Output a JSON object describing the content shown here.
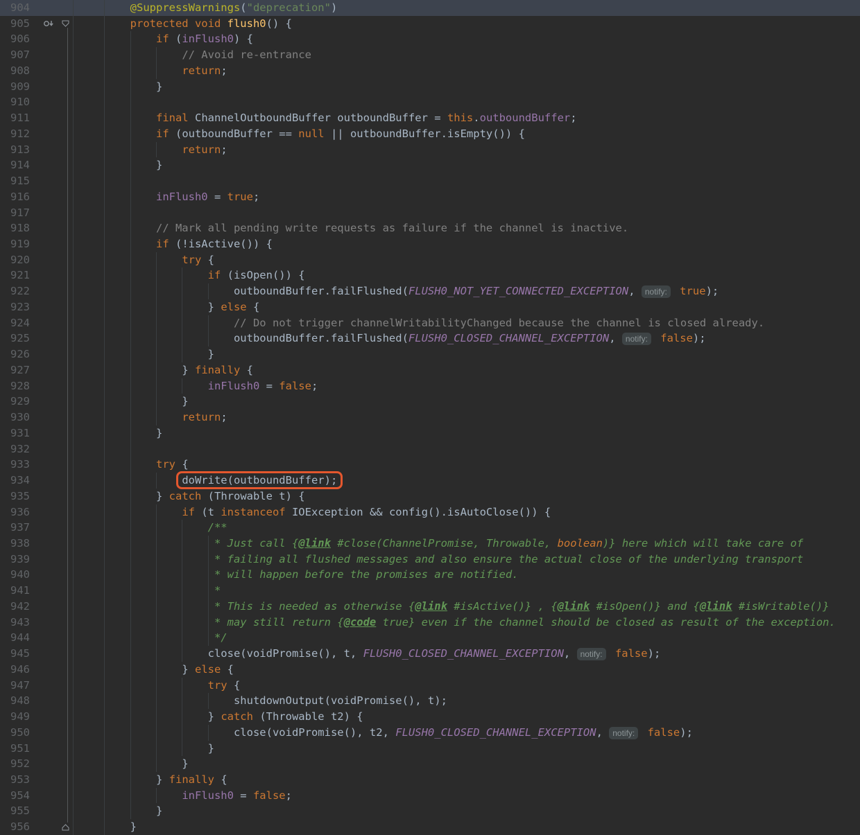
{
  "editor": {
    "palette": {
      "background": "#2b2b2b",
      "caretLine": "#3d434e",
      "lineNumber": "#606366",
      "gutterLine": "#3a3d3f",
      "guide": "#3a3e41",
      "foldLine": "#55585a",
      "d": "#a9b7c6",
      "kw": "#cc7832",
      "ann": "#bbb529",
      "str": "#6a8759",
      "cmt": "#808080",
      "doc": "#629755",
      "fld": "#9876aa",
      "cst": "#9876aa",
      "mth": "#ffc66d",
      "hintBg": "#3e4446",
      "hintText": "#8c9496",
      "box": "#e4572e",
      "icon": "#8f959b"
    },
    "inlay_hint_label": "notify:",
    "highlight_box": {
      "line": 934,
      "text": "doWrite(outboundBuffer);",
      "color": "#e4572e"
    },
    "lines": [
      {
        "n": 904,
        "caret": true,
        "seg": [
          [
            "d",
            "        "
          ],
          [
            "ann",
            "@SuppressWarnings"
          ],
          [
            "d",
            "("
          ],
          [
            "str",
            "\"deprecation\""
          ],
          [
            "d",
            ")"
          ]
        ]
      },
      {
        "n": 905,
        "icons": [
          "overridden-method-icon",
          "fold-start-icon"
        ],
        "seg": [
          [
            "d",
            "        "
          ],
          [
            "kw",
            "protected void "
          ],
          [
            "mth",
            "flush0"
          ],
          [
            "d",
            "() {"
          ]
        ]
      },
      {
        "n": 906,
        "seg": [
          [
            "d",
            "            "
          ],
          [
            "kw",
            "if "
          ],
          [
            "d",
            "("
          ],
          [
            "fld",
            "inFlush0"
          ],
          [
            "d",
            ") {"
          ]
        ]
      },
      {
        "n": 907,
        "seg": [
          [
            "d",
            "                "
          ],
          [
            "cmt",
            "// Avoid re-entrance"
          ]
        ]
      },
      {
        "n": 908,
        "seg": [
          [
            "d",
            "                "
          ],
          [
            "kw",
            "return"
          ],
          [
            "d",
            ";"
          ]
        ]
      },
      {
        "n": 909,
        "seg": [
          [
            "d",
            "            }"
          ]
        ]
      },
      {
        "n": 910,
        "seg": []
      },
      {
        "n": 911,
        "seg": [
          [
            "d",
            "            "
          ],
          [
            "kw",
            "final "
          ],
          [
            "d",
            "ChannelOutboundBuffer outboundBuffer = "
          ],
          [
            "kw",
            "this"
          ],
          [
            "d",
            "."
          ],
          [
            "fld",
            "outboundBuffer"
          ],
          [
            "d",
            ";"
          ]
        ]
      },
      {
        "n": 912,
        "seg": [
          [
            "d",
            "            "
          ],
          [
            "kw",
            "if "
          ],
          [
            "d",
            "(outboundBuffer == "
          ],
          [
            "kw",
            "null"
          ],
          [
            "d",
            " || outboundBuffer.isEmpty()) {"
          ]
        ]
      },
      {
        "n": 913,
        "seg": [
          [
            "d",
            "                "
          ],
          [
            "kw",
            "return"
          ],
          [
            "d",
            ";"
          ]
        ]
      },
      {
        "n": 914,
        "seg": [
          [
            "d",
            "            }"
          ]
        ]
      },
      {
        "n": 915,
        "seg": []
      },
      {
        "n": 916,
        "seg": [
          [
            "d",
            "            "
          ],
          [
            "fld",
            "inFlush0"
          ],
          [
            "d",
            " = "
          ],
          [
            "kw",
            "true"
          ],
          [
            "d",
            ";"
          ]
        ]
      },
      {
        "n": 917,
        "seg": []
      },
      {
        "n": 918,
        "seg": [
          [
            "d",
            "            "
          ],
          [
            "cmt",
            "// Mark all pending write requests as failure if the channel is inactive."
          ]
        ]
      },
      {
        "n": 919,
        "seg": [
          [
            "d",
            "            "
          ],
          [
            "kw",
            "if "
          ],
          [
            "d",
            "(!isActive()) {"
          ]
        ]
      },
      {
        "n": 920,
        "seg": [
          [
            "d",
            "                "
          ],
          [
            "kw",
            "try "
          ],
          [
            "d",
            "{"
          ]
        ]
      },
      {
        "n": 921,
        "seg": [
          [
            "d",
            "                    "
          ],
          [
            "kw",
            "if "
          ],
          [
            "d",
            "(isOpen()) {"
          ]
        ]
      },
      {
        "n": 922,
        "seg": [
          [
            "d",
            "                        outboundBuffer.failFlushed("
          ],
          [
            "cst",
            "FLUSH0_NOT_YET_CONNECTED_EXCEPTION"
          ],
          [
            "d",
            ", "
          ],
          [
            "hint",
            "notify:"
          ],
          [
            "d",
            " "
          ],
          [
            "kw",
            "true"
          ],
          [
            "d",
            ");"
          ]
        ]
      },
      {
        "n": 923,
        "seg": [
          [
            "d",
            "                    } "
          ],
          [
            "kw",
            "else "
          ],
          [
            "d",
            "{"
          ]
        ]
      },
      {
        "n": 924,
        "seg": [
          [
            "d",
            "                        "
          ],
          [
            "cmt",
            "// Do not trigger channelWritabilityChanged because the channel is closed already."
          ]
        ]
      },
      {
        "n": 925,
        "seg": [
          [
            "d",
            "                        outboundBuffer.failFlushed("
          ],
          [
            "cst",
            "FLUSH0_CLOSED_CHANNEL_EXCEPTION"
          ],
          [
            "d",
            ", "
          ],
          [
            "hint",
            "notify:"
          ],
          [
            "d",
            " "
          ],
          [
            "kw",
            "false"
          ],
          [
            "d",
            ");"
          ]
        ]
      },
      {
        "n": 926,
        "seg": [
          [
            "d",
            "                    }"
          ]
        ]
      },
      {
        "n": 927,
        "seg": [
          [
            "d",
            "                } "
          ],
          [
            "kw",
            "finally "
          ],
          [
            "d",
            "{"
          ]
        ]
      },
      {
        "n": 928,
        "seg": [
          [
            "d",
            "                    "
          ],
          [
            "fld",
            "inFlush0"
          ],
          [
            "d",
            " = "
          ],
          [
            "kw",
            "false"
          ],
          [
            "d",
            ";"
          ]
        ]
      },
      {
        "n": 929,
        "seg": [
          [
            "d",
            "                }"
          ]
        ]
      },
      {
        "n": 930,
        "seg": [
          [
            "d",
            "                "
          ],
          [
            "kw",
            "return"
          ],
          [
            "d",
            ";"
          ]
        ]
      },
      {
        "n": 931,
        "seg": [
          [
            "d",
            "            }"
          ]
        ]
      },
      {
        "n": 932,
        "seg": []
      },
      {
        "n": 933,
        "seg": [
          [
            "d",
            "            "
          ],
          [
            "kw",
            "try "
          ],
          [
            "d",
            "{"
          ]
        ]
      },
      {
        "n": 934,
        "seg": [
          [
            "d",
            "                "
          ],
          [
            "box",
            "doWrite(outboundBuffer);"
          ]
        ]
      },
      {
        "n": 935,
        "seg": [
          [
            "d",
            "            } "
          ],
          [
            "kw",
            "catch "
          ],
          [
            "d",
            "(Throwable t) {"
          ]
        ]
      },
      {
        "n": 936,
        "seg": [
          [
            "d",
            "                "
          ],
          [
            "kw",
            "if "
          ],
          [
            "d",
            "(t "
          ],
          [
            "kw",
            "instanceof "
          ],
          [
            "d",
            "IOException && config().isAutoClose()) {"
          ]
        ]
      },
      {
        "n": 937,
        "seg": [
          [
            "d",
            "                    "
          ],
          [
            "doc",
            "/**"
          ]
        ]
      },
      {
        "n": 938,
        "seg": [
          [
            "d",
            "                     "
          ],
          [
            "doc",
            "* Just call {"
          ],
          [
            "tag",
            "@link"
          ],
          [
            "doc",
            " #close(ChannelPromise, Throwable, "
          ],
          [
            "dkw",
            "boolean"
          ],
          [
            "doc",
            ")} here which will take care of"
          ]
        ]
      },
      {
        "n": 939,
        "seg": [
          [
            "d",
            "                     "
          ],
          [
            "doc",
            "* failing all flushed messages and also ensure the actual close of the underlying transport"
          ]
        ]
      },
      {
        "n": 940,
        "seg": [
          [
            "d",
            "                     "
          ],
          [
            "doc",
            "* will happen before the promises are notified."
          ]
        ]
      },
      {
        "n": 941,
        "seg": [
          [
            "d",
            "                     "
          ],
          [
            "doc",
            "*"
          ]
        ]
      },
      {
        "n": 942,
        "seg": [
          [
            "d",
            "                     "
          ],
          [
            "doc",
            "* This is needed as otherwise {"
          ],
          [
            "tag",
            "@link"
          ],
          [
            "doc",
            " #isActive()} , {"
          ],
          [
            "tag",
            "@link"
          ],
          [
            "doc",
            " #isOpen()} and {"
          ],
          [
            "tag",
            "@link"
          ],
          [
            "doc",
            " #isWritable()}"
          ]
        ]
      },
      {
        "n": 943,
        "seg": [
          [
            "d",
            "                     "
          ],
          [
            "doc",
            "* may still return {"
          ],
          [
            "tag",
            "@code"
          ],
          [
            "doc",
            " true} even if the channel should be closed as result of the exception."
          ]
        ]
      },
      {
        "n": 944,
        "seg": [
          [
            "d",
            "                     "
          ],
          [
            "doc",
            "*/"
          ]
        ]
      },
      {
        "n": 945,
        "seg": [
          [
            "d",
            "                    close(voidPromise(), t, "
          ],
          [
            "cst",
            "FLUSH0_CLOSED_CHANNEL_EXCEPTION"
          ],
          [
            "d",
            ", "
          ],
          [
            "hint",
            "notify:"
          ],
          [
            "d",
            " "
          ],
          [
            "kw",
            "false"
          ],
          [
            "d",
            ");"
          ]
        ]
      },
      {
        "n": 946,
        "seg": [
          [
            "d",
            "                } "
          ],
          [
            "kw",
            "else "
          ],
          [
            "d",
            "{"
          ]
        ]
      },
      {
        "n": 947,
        "seg": [
          [
            "d",
            "                    "
          ],
          [
            "kw",
            "try "
          ],
          [
            "d",
            "{"
          ]
        ]
      },
      {
        "n": 948,
        "seg": [
          [
            "d",
            "                        shutdownOutput(voidPromise(), t);"
          ]
        ]
      },
      {
        "n": 949,
        "seg": [
          [
            "d",
            "                    } "
          ],
          [
            "kw",
            "catch "
          ],
          [
            "d",
            "(Throwable t2) {"
          ]
        ]
      },
      {
        "n": 950,
        "seg": [
          [
            "d",
            "                        close(voidPromise(), t2, "
          ],
          [
            "cst",
            "FLUSH0_CLOSED_CHANNEL_EXCEPTION"
          ],
          [
            "d",
            ", "
          ],
          [
            "hint",
            "notify:"
          ],
          [
            "d",
            " "
          ],
          [
            "kw",
            "false"
          ],
          [
            "d",
            ");"
          ]
        ]
      },
      {
        "n": 951,
        "seg": [
          [
            "d",
            "                    }"
          ]
        ]
      },
      {
        "n": 952,
        "seg": [
          [
            "d",
            "                }"
          ]
        ]
      },
      {
        "n": 953,
        "seg": [
          [
            "d",
            "            } "
          ],
          [
            "kw",
            "finally "
          ],
          [
            "d",
            "{"
          ]
        ]
      },
      {
        "n": 954,
        "seg": [
          [
            "d",
            "                "
          ],
          [
            "fld",
            "inFlush0"
          ],
          [
            "d",
            " = "
          ],
          [
            "kw",
            "false"
          ],
          [
            "d",
            ";"
          ]
        ]
      },
      {
        "n": 955,
        "seg": [
          [
            "d",
            "            }"
          ]
        ]
      },
      {
        "n": 956,
        "icons": [
          "fold-end-icon"
        ],
        "seg": [
          [
            "d",
            "        }"
          ]
        ]
      }
    ]
  }
}
